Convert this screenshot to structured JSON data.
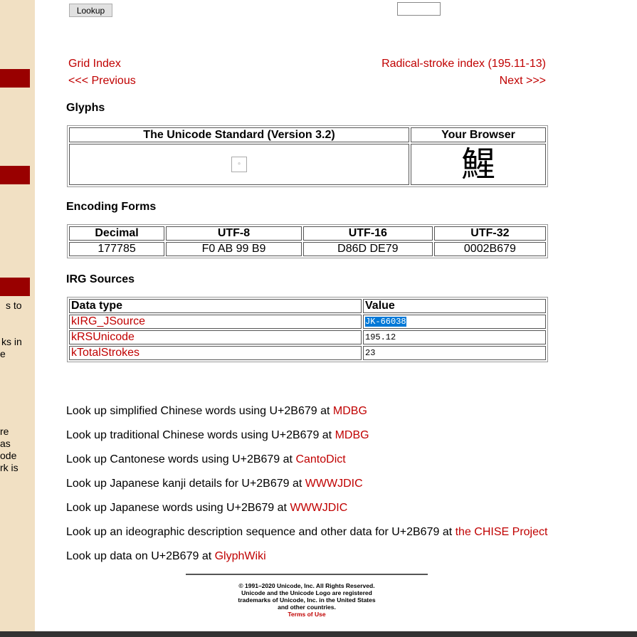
{
  "sidebar": {
    "fragments": [
      "s to",
      "ks in",
      "e",
      "re",
      "as",
      "ode",
      "rk is"
    ]
  },
  "top": {
    "lookup_label": "Lookup",
    "input_value": ""
  },
  "nav": {
    "grid_index": "Grid Index",
    "radical_index": "Radical-stroke index (195.11-13)",
    "previous": "<<< Previous",
    "next": "Next >>>"
  },
  "glyphs": {
    "heading": "Glyphs",
    "col1": "The Unicode Standard (Version 3.2)",
    "col2": "Your Browser",
    "char": "鯹"
  },
  "encoding": {
    "heading": "Encoding Forms",
    "headers": [
      "Decimal",
      "UTF-8",
      "UTF-16",
      "UTF-32"
    ],
    "values": [
      "177785",
      "F0 AB 99 B9",
      "D86D DE79",
      "0002B679"
    ]
  },
  "irg": {
    "heading": "IRG Sources",
    "headers": [
      "Data type",
      "Value"
    ],
    "rows": [
      {
        "type": "kIRG_JSource",
        "value": "JK-66038"
      },
      {
        "type": "kRSUnicode",
        "value": "195.12"
      },
      {
        "type": "kTotalStrokes",
        "value": "23"
      }
    ]
  },
  "lookups": [
    {
      "text": "Look up simplified Chinese words using U+2B679 at ",
      "link": "MDBG"
    },
    {
      "text": "Look up traditional Chinese words using U+2B679 at ",
      "link": "MDBG"
    },
    {
      "text": "Look up Cantonese words using U+2B679 at ",
      "link": "CantoDict"
    },
    {
      "text": "Look up Japanese kanji details for U+2B679 at ",
      "link": "WWWJDIC"
    },
    {
      "text": "Look up Japanese words using U+2B679 at ",
      "link": "WWWJDIC"
    },
    {
      "text": "Look up an ideographic description sequence and other data for U+2B679 at ",
      "link": "the CHISE Project"
    },
    {
      "text": "Look up data on U+2B679 at ",
      "link": "GlyphWiki"
    }
  ],
  "footer": {
    "lines": [
      "© 1991–2020 Unicode, Inc. All Rights Reserved.",
      "Unicode and the Unicode Logo are registered",
      "trademarks of Unicode, Inc. in the United States",
      "and other countries."
    ],
    "terms": "Terms of Use"
  }
}
